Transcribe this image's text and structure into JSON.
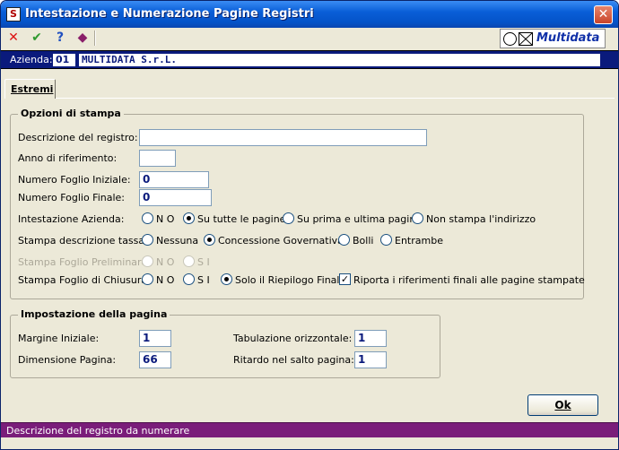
{
  "window": {
    "title": "Intestazione e Numerazione Pagine Registri",
    "app_icon": "S",
    "close_glyph": "✕"
  },
  "toolbar": {
    "icons": [
      "close-red-x-icon",
      "confirm-check-icon",
      "help-question-icon",
      "book-icon"
    ],
    "logo_text": "Multidata"
  },
  "company": {
    "label": "Azienda:",
    "code": "01",
    "name": "MULTIDATA S.r.L."
  },
  "tabs": [
    {
      "label": "Estremi"
    }
  ],
  "print_options": {
    "title": "Opzioni di stampa",
    "description_label": "Descrizione del registro:",
    "description_value": "",
    "year_label": "Anno di riferimento:",
    "year_value": "",
    "start_page_label": "Numero Foglio Iniziale:",
    "start_page_value": "0",
    "end_page_label": "Numero Foglio Finale:",
    "end_page_value": "0",
    "company_header": {
      "label": "Intestazione Azienda:",
      "options": [
        "N O",
        "Su tutte le pagine",
        "Su prima e ultima pagina",
        "Non stampa l'indirizzo"
      ],
      "selected": "Su tutte le pagine"
    },
    "tax_description": {
      "label": "Stampa descrizione tassa:",
      "options": [
        "Nessuna",
        "Concessione Governativa",
        "Bolli",
        "Entrambe"
      ],
      "selected": "Concessione Governativa"
    },
    "preliminary_sheet": {
      "label": "Stampa Foglio Preliminare:",
      "options": [
        "N O",
        "S I"
      ],
      "selected": "",
      "disabled": true
    },
    "closing_sheet": {
      "label": "Stampa Foglio di Chiusura:",
      "options": [
        "N O",
        "S I",
        "Solo il Riepilogo Finale"
      ],
      "selected": "Solo il Riepilogo Finale",
      "checkbox_label": "Riporta i riferimenti finali alle pagine stampate",
      "checkbox_checked": true
    }
  },
  "page_setup": {
    "title": "Impostazione della pagina",
    "initial_margin_label": "Margine Iniziale:",
    "initial_margin_value": "1",
    "page_size_label": "Dimensione Pagina:",
    "page_size_value": "66",
    "horizontal_tab_label": "Tabulazione orizzontale:",
    "horizontal_tab_value": "1",
    "page_break_delay_label": "Ritardo nel salto pagina:",
    "page_break_delay_value": "1"
  },
  "buttons": {
    "ok_label": "Ok"
  },
  "status": {
    "text": "Descrizione del registro da numerare"
  }
}
